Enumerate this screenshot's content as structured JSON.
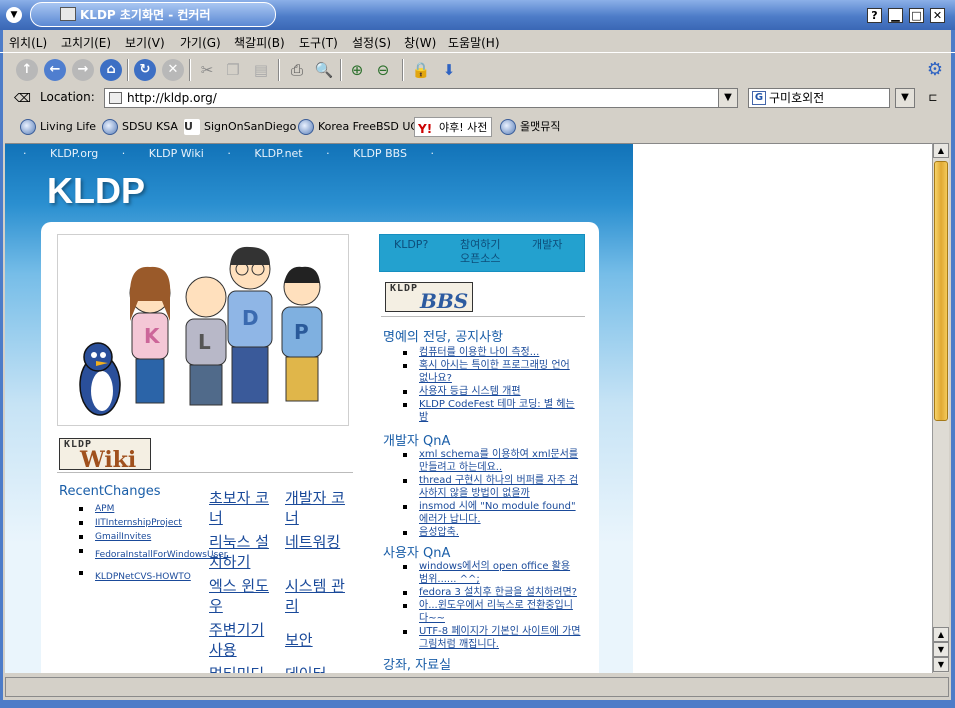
{
  "window": {
    "title": "KLDP 초기화면 - 컨커러",
    "buttons": [
      "?",
      "▁",
      "□",
      "✕"
    ]
  },
  "menubar": [
    "위치(L)",
    "고치기(E)",
    "보기(V)",
    "가기(G)",
    "책갈피(B)",
    "도구(T)",
    "설정(S)",
    "창(W)",
    "도움말(H)"
  ],
  "toolbar": {
    "icons": [
      "up-icon",
      "back-icon",
      "forward-icon",
      "home-icon",
      "reload-icon",
      "stop-icon",
      "cut-icon",
      "copy-icon",
      "paste-icon",
      "print-icon",
      "find-icon",
      "zoom-in-icon",
      "zoom-out-icon",
      "lock-icon",
      "download-icon",
      "settings-gear-icon"
    ]
  },
  "location": {
    "label": "Location:",
    "url": "http://kldp.org/",
    "search_value": "구미호외전"
  },
  "bookmarks": [
    "Living Life",
    "SDSU KSA",
    "SignOnSanDiego",
    "Korea FreeBSD UG",
    "야후! 사전",
    "올맷뮤직"
  ],
  "bookmark_special": {
    "logo_text": "U",
    "yahoo_logo": "Y!"
  },
  "page": {
    "topnav": [
      "KLDP.org",
      "KLDP Wiki",
      "KLDP.net",
      "KLDP BBS"
    ],
    "topnav_sep": "·",
    "logo": "KLDP",
    "hero_letters": [
      "K",
      "L",
      "D",
      "P"
    ],
    "wiki_logo_top": "KLDP",
    "wiki_logo_main": "Wiki",
    "recent_changes_title": "RecentChanges",
    "recent_changes": [
      "APM",
      "IITInternshipProject",
      "GmailInvites",
      "FedoraInstallForWindowsUser",
      "KLDPNetCVS-HOWTO"
    ],
    "categories": [
      "초보자 코너",
      "개발자 코너",
      "리눅스 설치하기",
      "네트워킹",
      "엑스 윈도우",
      "시스템 관리",
      "주변기기 사용",
      "보안",
      "멀티미디",
      "데이터"
    ],
    "tabs": [
      "KLDP?",
      "참여하기",
      "개발자",
      "오픈소스"
    ],
    "bbs_logo_top": "KLDP",
    "bbs_logo_main": "BBS",
    "sections": [
      {
        "title": "명예의 전당, 공지사항",
        "items": [
          "컴퓨터를 이용한 나이 측정...",
          "혹시 아시는 특이한 프로그래밍 언어 없나요?",
          "사용자 등급 시스템 개편",
          "KLDP CodeFest 테마 코딩: 별 헤는 밤"
        ]
      },
      {
        "title": "개발자 QnA",
        "items": [
          "xml schema를 이용하여 xml문서를 만들려고 하는데요..",
          "thread 구현시 하나의 버퍼를 자주 검사하지 않을 방법이 없을까",
          "insmod 시에 \"No module found\" 에러가 납니다.",
          "음성압축."
        ]
      },
      {
        "title": "사용자 QnA",
        "items": [
          "windows에서의 open office 활용 범위...... ^^;",
          "fedora 3 설치후 한글을 설치하려면?",
          "아...윈도우에서 리눅스로 전환중입니다~~",
          "UTF-8 페이지가 기본인 사이트에 가면 그림처럼 깨집니다."
        ]
      },
      {
        "title": "강좌, 자료실",
        "items": []
      }
    ]
  },
  "scrollbar": {
    "up": "▲",
    "down": "▼",
    "down2": "▼",
    "up2": "▲"
  }
}
